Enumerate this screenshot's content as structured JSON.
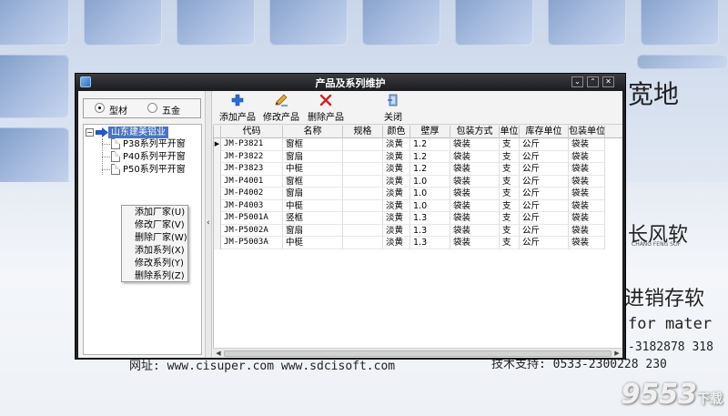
{
  "window": {
    "title": "产品及系列维护",
    "controls": [
      "⌄",
      "⌃",
      "✕"
    ]
  },
  "filter": {
    "options": [
      {
        "label": "型材",
        "selected": true
      },
      {
        "label": "五金",
        "selected": false
      }
    ]
  },
  "tree": {
    "root": "山东建美铝业",
    "children": [
      "P38系列平开窗",
      "P40系列平开窗",
      "P50系列平开窗"
    ]
  },
  "context_menu": {
    "items": [
      "添加厂家(U)",
      "修改厂家(V)",
      "删除厂家(W)",
      "添加系列(X)",
      "修改系列(Y)",
      "删除系列(Z)"
    ]
  },
  "toolbar": {
    "add_label": "添加产品",
    "edit_label": "修改产品",
    "delete_label": "删除产品",
    "close_label": "关闭",
    "add_icon": "plus-icon",
    "edit_icon": "pencil-icon",
    "delete_icon": "delete-x-icon",
    "close_icon": "exit-door-icon"
  },
  "grid": {
    "columns": [
      "代码",
      "名称",
      "规格",
      "颜色",
      "壁厚",
      "包装方式",
      "单位",
      "库存单位",
      "包装单位"
    ],
    "rows": [
      [
        "JM-P3821",
        "窗框",
        "",
        "淡黄",
        "1.2",
        "袋装",
        "支",
        "公斤",
        "袋装"
      ],
      [
        "JM-P3822",
        "窗扇",
        "",
        "淡黄",
        "1.2",
        "袋装",
        "支",
        "公斤",
        "袋装"
      ],
      [
        "JM-P3823",
        "中梃",
        "",
        "淡黄",
        "1.2",
        "袋装",
        "支",
        "公斤",
        "袋装"
      ],
      [
        "JM-P4001",
        "窗框",
        "",
        "淡黄",
        "1.0",
        "袋装",
        "支",
        "公斤",
        "袋装"
      ],
      [
        "JM-P4002",
        "窗扇",
        "",
        "淡黄",
        "1.0",
        "袋装",
        "支",
        "公斤",
        "袋装"
      ],
      [
        "JM-P4003",
        "中梃",
        "",
        "淡黄",
        "1.0",
        "袋装",
        "支",
        "公斤",
        "袋装"
      ],
      [
        "JM-P5001A",
        "竖框",
        "",
        "淡黄",
        "1.3",
        "袋装",
        "支",
        "公斤",
        "袋装"
      ],
      [
        "JM-P5002A",
        "窗扇",
        "",
        "淡黄",
        "1.3",
        "袋装",
        "支",
        "公斤",
        "袋装"
      ],
      [
        "JM-P5003A",
        "中梃",
        "",
        "淡黄",
        "1.3",
        "袋装",
        "支",
        "公斤",
        "袋装"
      ]
    ]
  },
  "background": {
    "headline": "宽地",
    "brand_cn": "长风软",
    "brand_en": "CHANG FENG SOF",
    "slogan": "进销存软",
    "slogan_en": "for mater",
    "phone_right": "-3182878 318",
    "url_line": "网址: www.cisuper.com  www.sdcisoft.com",
    "support_line": "技术支持: 0533-2300228 230",
    "watermark": "9553",
    "watermark_sub": "下载"
  }
}
